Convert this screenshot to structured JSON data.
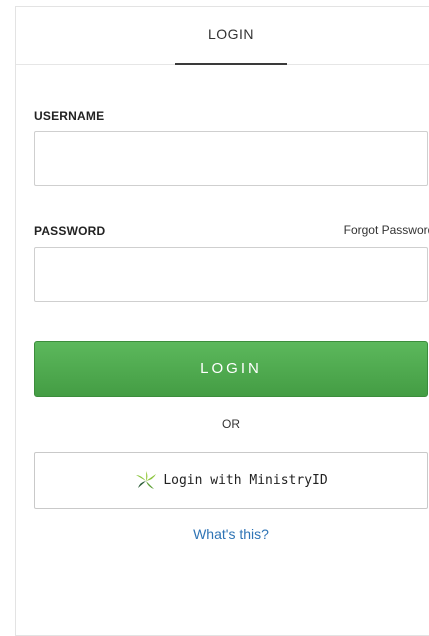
{
  "tabs": {
    "login_label": "LOGIN"
  },
  "form": {
    "username_label": "USERNAME",
    "username_value": "",
    "password_label": "PASSWORD",
    "password_value": "",
    "forgot_password": "Forgot Password?",
    "login_button": "LOGIN",
    "or_text": "OR",
    "ministry_button": "Login with MinistryID",
    "whats_this": "What's this?"
  },
  "colors": {
    "login_button": "#4cae4c",
    "link": "#2f74b5",
    "ministry_logo_green": "#8dc63f",
    "ministry_logo_dark": "#2e5e3a"
  },
  "icons": {
    "ministry_logo": "ministryid-leaf-logo"
  }
}
